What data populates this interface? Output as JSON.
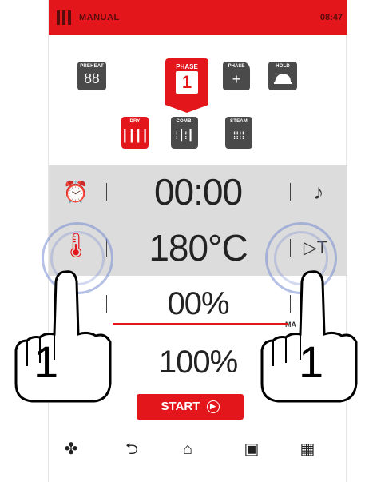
{
  "header": {
    "mode": "MANUAL",
    "clock": "08:47"
  },
  "phase_buttons": {
    "preheat": "PREHEAT",
    "phase_label": "PHASE",
    "phase_number": "1",
    "phase_add_label": "PHASE",
    "phase_add_glyph": "+",
    "hold": "HOLD"
  },
  "modes": {
    "dry": "DRY",
    "combi": "COMBI",
    "steam": "STEAM"
  },
  "rows": {
    "time": "00:00",
    "temperature": "180°C",
    "humidity": "00%",
    "fan": "100%",
    "humidity_label": "MA",
    "delta_label": "MA"
  },
  "start": {
    "label": "START"
  },
  "touch": {
    "left_count": "1",
    "right_count": "1"
  },
  "icons": {
    "alarm": "alarm-clock-icon",
    "probe": "probe-icon",
    "thermometer": "thermometer-icon",
    "delta_t": "delta-t-icon",
    "fan": "fan-icon",
    "back": "back-icon",
    "home": "home-icon",
    "save": "save-icon",
    "clean": "clean-icon"
  },
  "colors": {
    "accent": "#e3161c",
    "dark_button": "#4a4a4a",
    "row_bg": "#dcdcdc"
  }
}
